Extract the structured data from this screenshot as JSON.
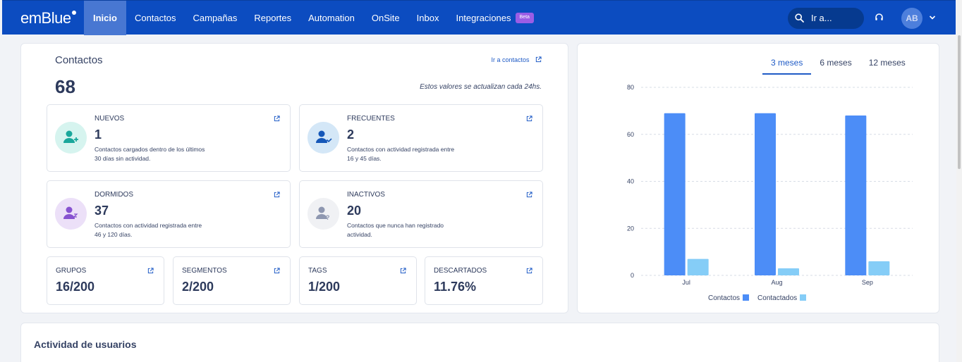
{
  "app": {
    "logo_text": "emBlue",
    "nav": [
      "Inicio",
      "Contactos",
      "Campañas",
      "Reportes",
      "Automation",
      "OnSite",
      "Inbox",
      "Integraciones"
    ],
    "beta_badge": "Beta",
    "search_placeholder": "Ir a...",
    "avatar_initials": "AB",
    "brand_color": "#0c4cc0"
  },
  "contacts": {
    "title": "Contactos",
    "link": "Ir a contactos",
    "total": "68",
    "note": "Estos valores se actualizan cada 24hs.",
    "stats": [
      {
        "label": "NUEVOS",
        "value": "1",
        "desc": [
          "Contactos cargados dentro de los últimos",
          "30 días sin actividad."
        ],
        "icon": "user-plus-icon",
        "color": "#d6f4ef",
        "icon_color": "#1aa79b"
      },
      {
        "label": "FRECUENTES",
        "value": "2",
        "desc": [
          "Contactos con actividad registrada entre",
          "16 y 45 días."
        ],
        "icon": "user-trend-icon",
        "color": "#d4e7f7",
        "icon_color": "#1557b8"
      },
      {
        "label": "DORMIDOS",
        "value": "37",
        "desc": [
          "Contactos con actividad registrada entre",
          "46 y 120 días."
        ],
        "icon": "user-sleep-icon",
        "color": "#ece0f8",
        "icon_color": "#8752d0"
      },
      {
        "label": "INACTIVOS",
        "value": "20",
        "desc": [
          "Contactos que nunca han registrado",
          "actividad."
        ],
        "icon": "user-question-icon",
        "color": "#f0f1f4",
        "icon_color": "#8e97b0"
      }
    ],
    "small_stats": [
      {
        "label": "GRUPOS",
        "value": "16/200"
      },
      {
        "label": "SEGMENTOS",
        "value": "2/200"
      },
      {
        "label": "TAGS",
        "value": "1/200"
      },
      {
        "label": "DESCARTADOS",
        "value": "11.76%"
      }
    ]
  },
  "chart_tabs": [
    "3 meses",
    "6 meses",
    "12 meses"
  ],
  "chart_data": {
    "type": "bar",
    "categories": [
      "Jul",
      "Aug",
      "Sep"
    ],
    "series": [
      {
        "name": "Contactos",
        "values": [
          69,
          69,
          68
        ],
        "color": "#4c8df7"
      },
      {
        "name": "Contactados",
        "values": [
          7,
          3,
          6
        ],
        "color": "#85cdf7"
      }
    ],
    "ylim": [
      0,
      80
    ],
    "yticks": [
      0,
      20,
      40,
      60,
      80
    ],
    "grid": true,
    "legend": "bottom"
  },
  "activity": {
    "title": "Actividad de usuarios"
  }
}
